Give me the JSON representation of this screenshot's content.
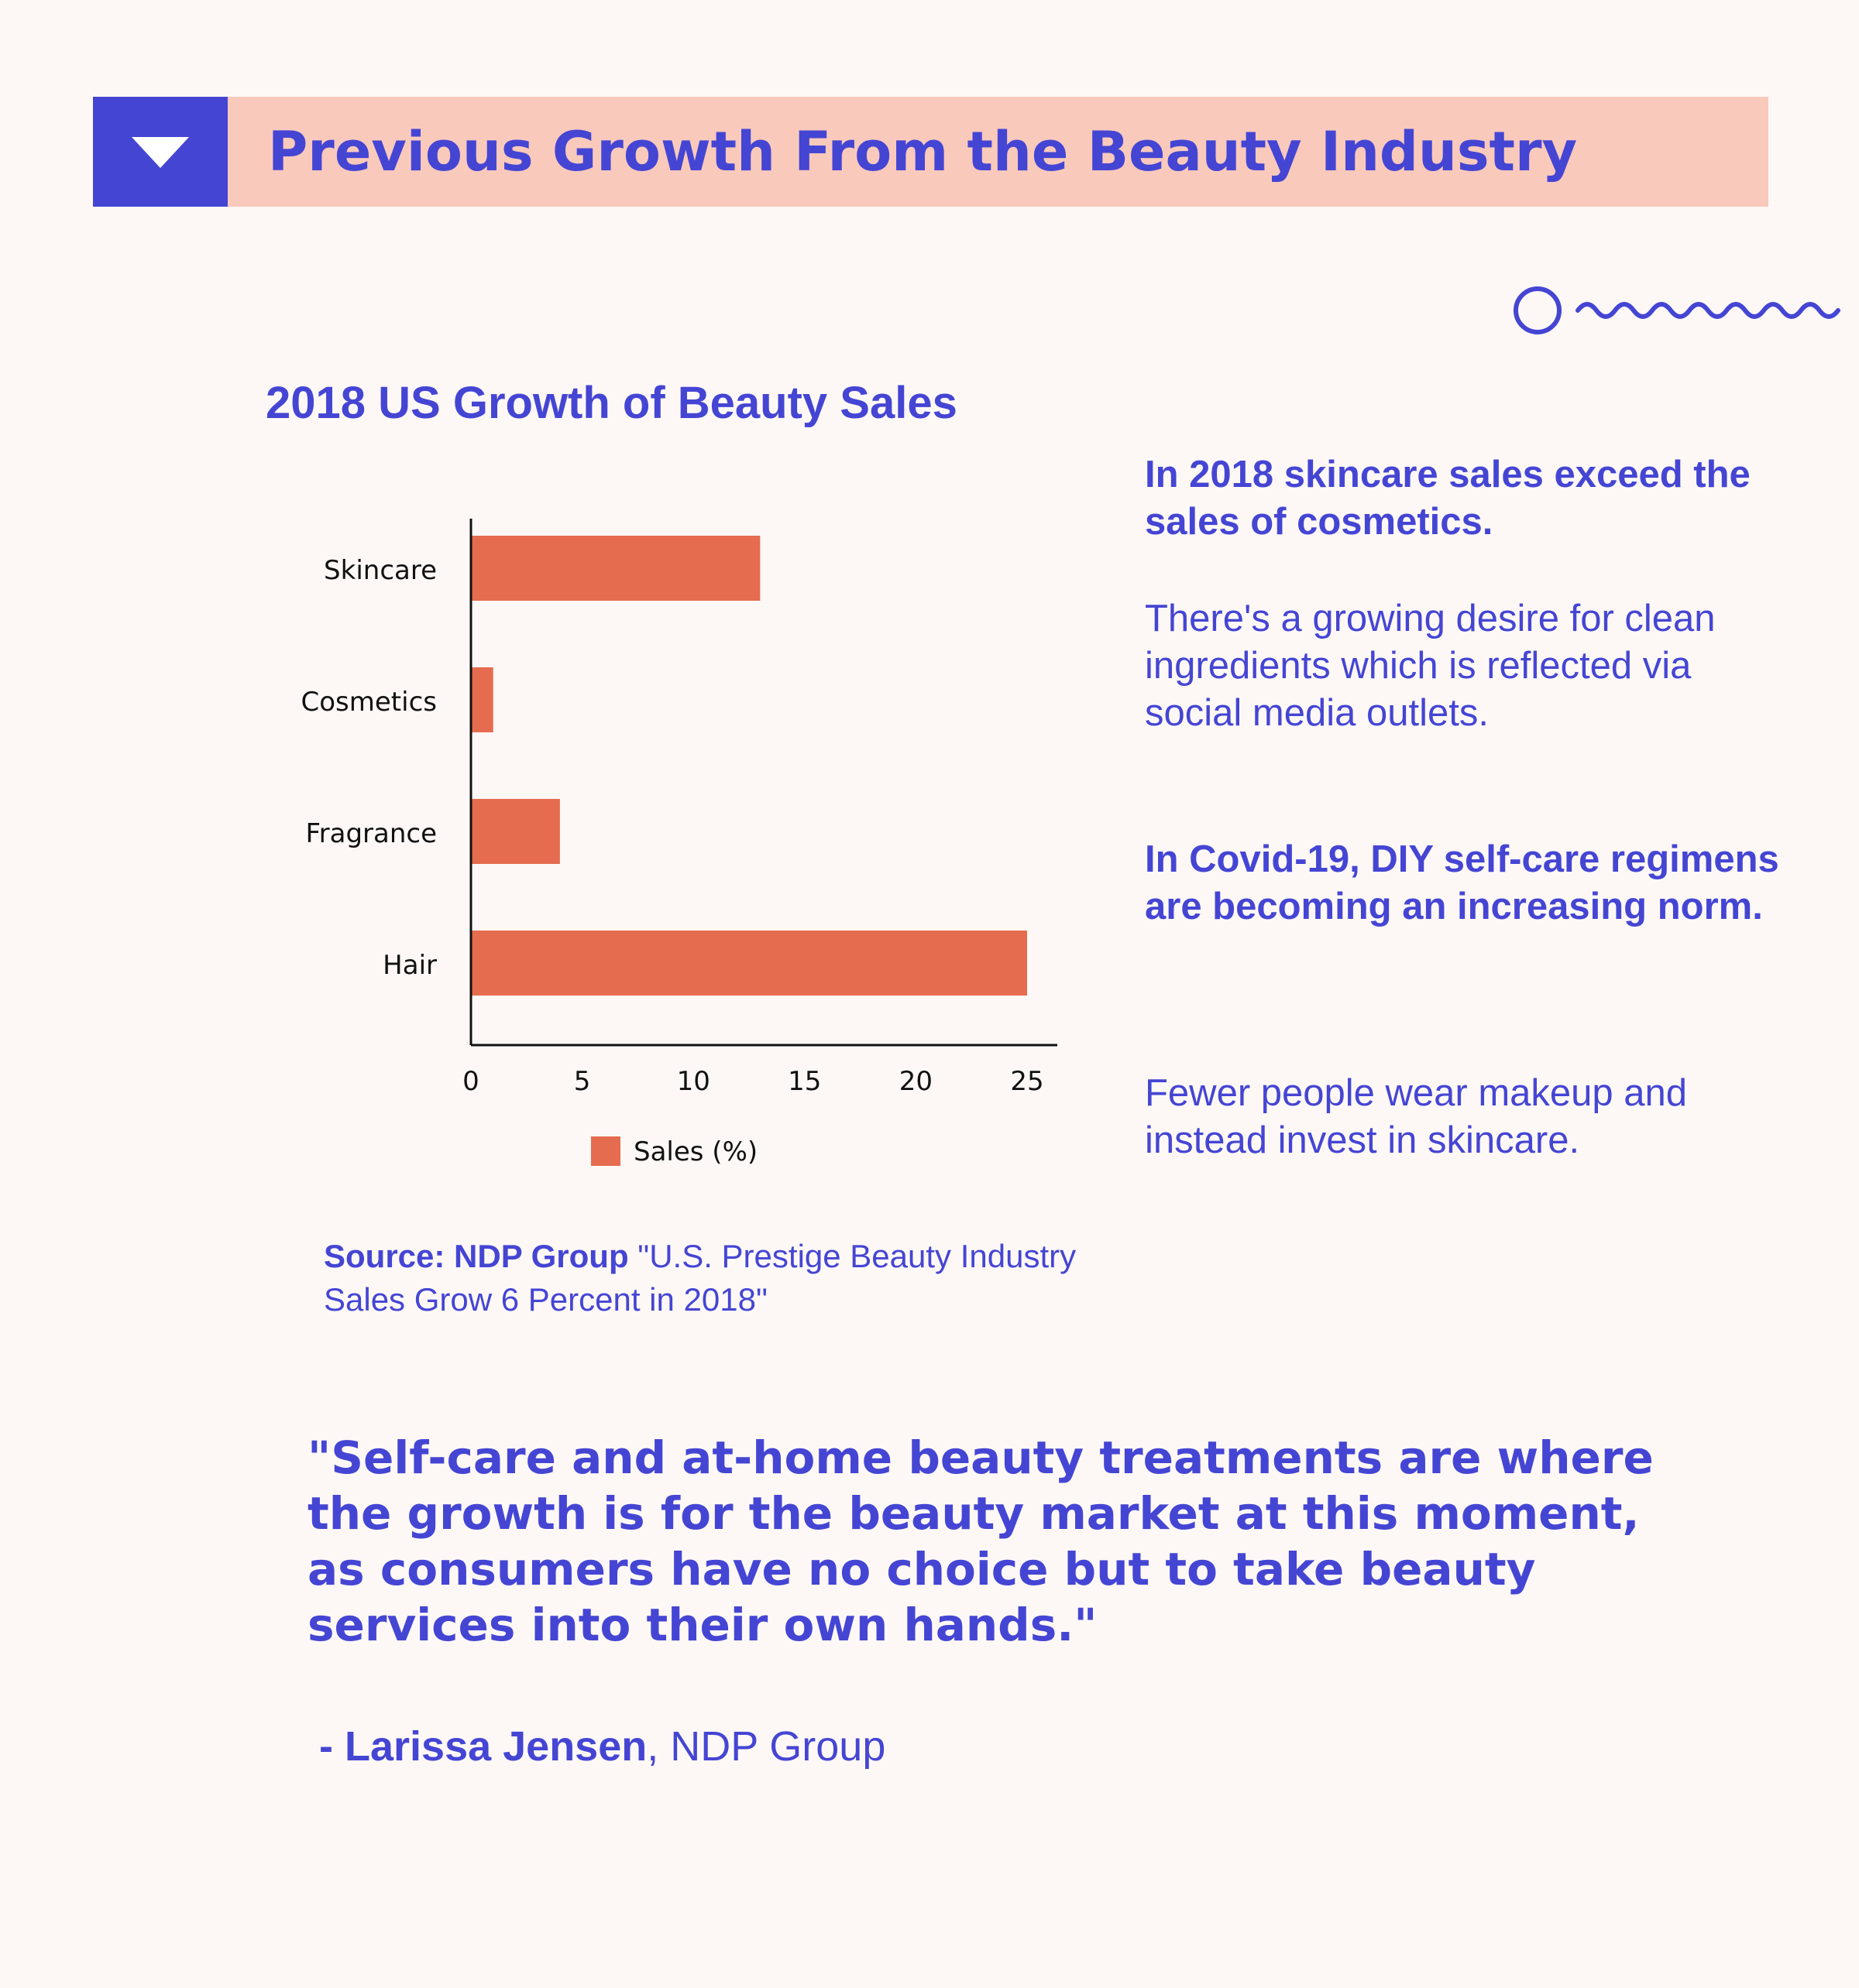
{
  "header": {
    "title": "Previous Growth From the Beauty Industry",
    "icon": "triangle-down-icon"
  },
  "decoration": {
    "icon": "circle-squiggle-icon"
  },
  "colors": {
    "accent": "#4545d4",
    "bar": "#e56c4e",
    "header_band": "#f9c9bc",
    "background": "#fdf8f6"
  },
  "chart_title": "2018 US Growth of Beauty Sales",
  "chart_data": {
    "type": "bar",
    "orientation": "horizontal",
    "title": "2018 US Growth of Beauty Sales",
    "categories": [
      "Skincare",
      "Cosmetics",
      "Fragrance",
      "Hair"
    ],
    "series": [
      {
        "name": "Sales (%)",
        "values": [
          13,
          1,
          4,
          25
        ]
      }
    ],
    "xlim": [
      0,
      25
    ],
    "xticks": [
      0,
      5,
      10,
      15,
      20,
      25
    ],
    "grid": false,
    "legend": "bottom-center"
  },
  "source": {
    "label": "Source: NDP Group",
    "text": " \"U.S. Prestige Beauty Industry Sales Grow 6 Percent in 2018\""
  },
  "sidebar": {
    "heading1": "In 2018 skincare sales exceed the sales of cosmetics.",
    "body1": "There's a growing desire for clean ingredients which is reflected via social media outlets.",
    "heading2": "In Covid-19, DIY self-care regimens are becoming an increasing norm.",
    "body2": "Fewer people wear makeup and instead invest in skincare."
  },
  "quote": {
    "text": "\"Self-care and at-home beauty treatments are where the growth is for the beauty market at this moment, as consumers have no choice but to take beauty services into their own hands.\"",
    "dash": "- ",
    "name": "Larissa Jensen",
    "org": ", NDP Group"
  }
}
